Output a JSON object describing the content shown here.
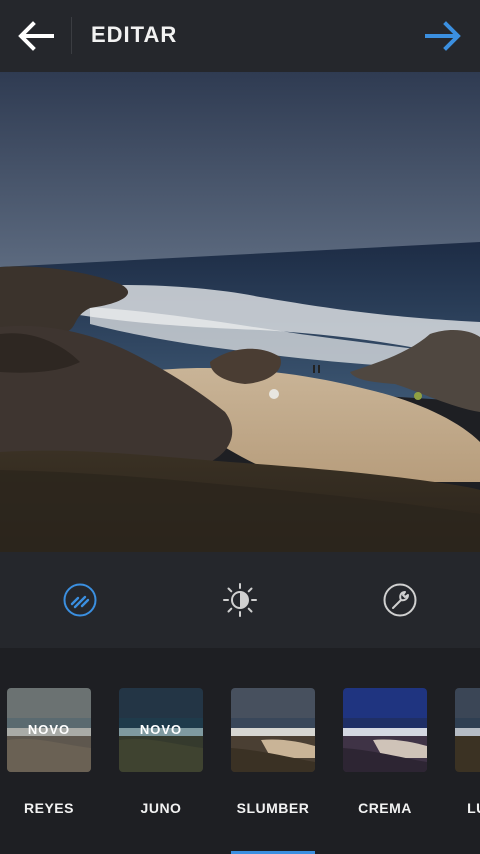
{
  "header": {
    "title": "EDITAR",
    "accent_color": "#3b8fe0"
  },
  "photo": {
    "description_icon": "beach-photo"
  },
  "tools": [
    {
      "name": "lux-icon",
      "active": true
    },
    {
      "name": "brightness-icon",
      "active": false
    },
    {
      "name": "wrench-icon",
      "active": false
    }
  ],
  "filters": [
    {
      "label": "REYES",
      "badge": "NOVO",
      "selected": false
    },
    {
      "label": "JUNO",
      "badge": "NOVO",
      "selected": false
    },
    {
      "label": "SLUMBER",
      "badge": "",
      "selected": true
    },
    {
      "label": "CREMA",
      "badge": "",
      "selected": false
    },
    {
      "label": "LUDWIG",
      "badge": "",
      "selected": false
    }
  ]
}
